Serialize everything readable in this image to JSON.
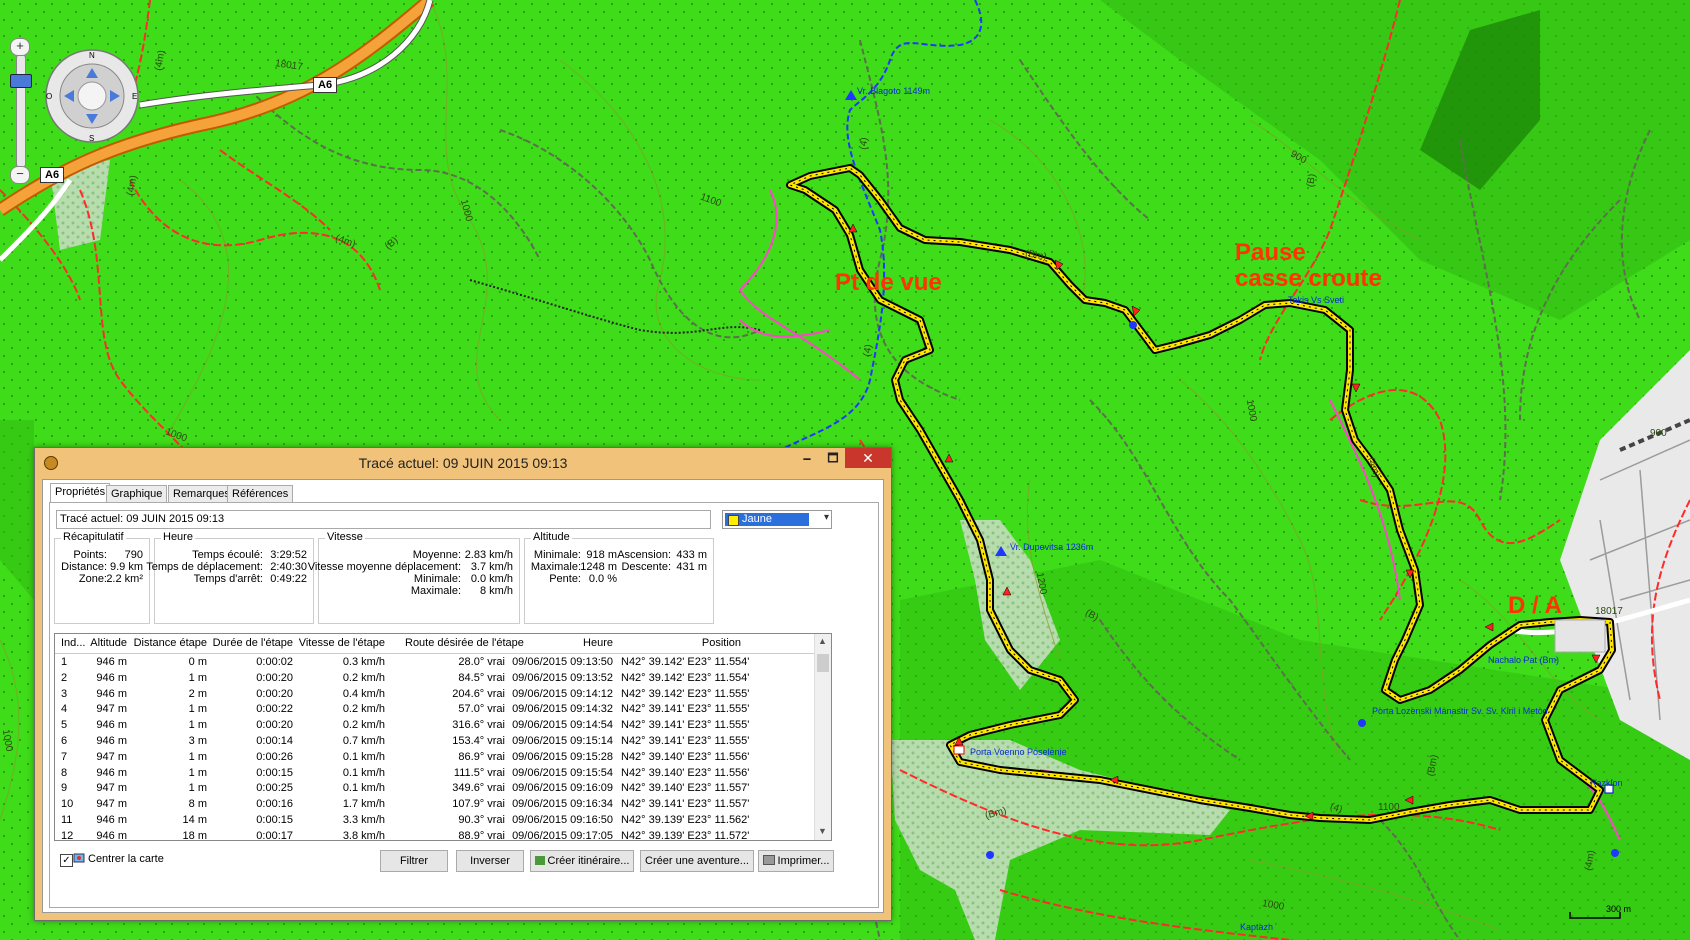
{
  "map": {
    "road_shields": [
      "A6",
      "A6"
    ],
    "road_numbers": [
      "18017",
      "18017"
    ],
    "contours": [
      "1000",
      "1100",
      "1000",
      "1200",
      "1000",
      "1100",
      "1000",
      "900",
      "900",
      "1000"
    ],
    "track_labels": [
      "(4m)",
      "(B)",
      "(4m)",
      "(4)",
      "(4)",
      "(B)",
      "(Bm)",
      "(Bm)",
      "(4m)",
      "(4)",
      "(Bm)",
      "(4m)",
      "(B)",
      "(4m)"
    ],
    "pois": [
      "Vr. Blagoto 1149m",
      "Takis Vs Sveti",
      "Vr. Dupevitsa 1236m",
      "Nachalo Pat (Bm)",
      "Porta Lozenski Manastir Sv. Sv. Kiril i Metod",
      "Porta Voenno Poselenie",
      "Razklon",
      "Kaptazh"
    ],
    "annotations": {
      "viewpoint": "Pt de vue",
      "pause": "Pause\ncasse croute",
      "start": "D / A"
    },
    "scale": "300 m",
    "colors": {
      "background": "#3fdc19",
      "track": "#ffe600",
      "trail_red": "#ff2a2a",
      "trail_blue": "#1f37ff"
    }
  },
  "window": {
    "title": "Tracé actuel: 09 JUIN 2015 09:13",
    "controls": {
      "minimize": "🗕",
      "maximize": "🗖",
      "close": "✕"
    },
    "tabs": [
      "Propriétés",
      "Graphique",
      "Remarques",
      "Références"
    ],
    "name_value": "Tracé actuel: 09 JUIN 2015 09:13",
    "color": {
      "label": "Jaune",
      "swatch": "#ffee00"
    },
    "summary": {
      "title": "Récapitulatif",
      "rows": [
        {
          "label": "Points:",
          "value": "790"
        },
        {
          "label": "Distance:",
          "value": "9.9 km"
        },
        {
          "label": "Zone:",
          "value": "2.2 km²"
        }
      ]
    },
    "time": {
      "title": "Heure",
      "rows": [
        {
          "label": "Temps écoulé:",
          "value": "3:29:52"
        },
        {
          "label": "Temps de déplacement:",
          "value": "2:40:30"
        },
        {
          "label": "Temps d'arrêt:",
          "value": "0:49:22"
        }
      ]
    },
    "speed": {
      "title": "Vitesse",
      "rows": [
        {
          "label": "Moyenne:",
          "value": "2.83 km/h"
        },
        {
          "label": "Vitesse moyenne déplacement:",
          "value": "3.7 km/h"
        },
        {
          "label": "Minimale:",
          "value": "0.0 km/h"
        },
        {
          "label": "Maximale:",
          "value": "8 km/h"
        }
      ]
    },
    "altitude": {
      "title": "Altitude",
      "rows": [
        {
          "label": "Minimale:",
          "value": "918 m"
        },
        {
          "label": "Maximale:",
          "value": "1248 m"
        },
        {
          "label": "Pente:",
          "value": "0.0 %"
        }
      ],
      "rows2": [
        {
          "label": "Ascension:",
          "value": "433 m"
        },
        {
          "label": "Descente:",
          "value": "431 m"
        }
      ]
    },
    "table": {
      "columns": [
        "Ind...",
        "Altitude",
        "Distance étape",
        "Durée de l'étape",
        "Vitesse de l'étape",
        "Route désirée de l'étape",
        "Heure",
        "Position"
      ],
      "rows": [
        [
          "1",
          "946 m",
          "0 m",
          "0:00:02",
          "0.3 km/h",
          "28.0° vrai",
          "09/06/2015 09:13:50",
          "N42° 39.142' E23° 11.554'"
        ],
        [
          "2",
          "946 m",
          "1 m",
          "0:00:20",
          "0.2 km/h",
          "84.5° vrai",
          "09/06/2015 09:13:52",
          "N42° 39.142' E23° 11.554'"
        ],
        [
          "3",
          "946 m",
          "2 m",
          "0:00:20",
          "0.4 km/h",
          "204.6° vrai",
          "09/06/2015 09:14:12",
          "N42° 39.142' E23° 11.555'"
        ],
        [
          "4",
          "947 m",
          "1 m",
          "0:00:22",
          "0.2 km/h",
          "57.0° vrai",
          "09/06/2015 09:14:32",
          "N42° 39.141' E23° 11.555'"
        ],
        [
          "5",
          "946 m",
          "1 m",
          "0:00:20",
          "0.2 km/h",
          "316.6° vrai",
          "09/06/2015 09:14:54",
          "N42° 39.141' E23° 11.555'"
        ],
        [
          "6",
          "946 m",
          "3 m",
          "0:00:14",
          "0.7 km/h",
          "153.4° vrai",
          "09/06/2015 09:15:14",
          "N42° 39.141' E23° 11.555'"
        ],
        [
          "7",
          "947 m",
          "1 m",
          "0:00:26",
          "0.1 km/h",
          "86.9° vrai",
          "09/06/2015 09:15:28",
          "N42° 39.140' E23° 11.556'"
        ],
        [
          "8",
          "946 m",
          "1 m",
          "0:00:15",
          "0.1 km/h",
          "111.5° vrai",
          "09/06/2015 09:15:54",
          "N42° 39.140' E23° 11.556'"
        ],
        [
          "9",
          "947 m",
          "1 m",
          "0:00:25",
          "0.1 km/h",
          "349.6° vrai",
          "09/06/2015 09:16:09",
          "N42° 39.140' E23° 11.557'"
        ],
        [
          "10",
          "947 m",
          "8 m",
          "0:00:16",
          "1.7 km/h",
          "107.9° vrai",
          "09/06/2015 09:16:34",
          "N42° 39.141' E23° 11.557'"
        ],
        [
          "11",
          "946 m",
          "14 m",
          "0:00:15",
          "3.3 km/h",
          "90.3° vrai",
          "09/06/2015 09:16:50",
          "N42° 39.139' E23° 11.562'"
        ],
        [
          "12",
          "946 m",
          "18 m",
          "0:00:17",
          "3.8 km/h",
          "88.9° vrai",
          "09/06/2015 09:17:05",
          "N42° 39.139' E23° 11.572'"
        ]
      ]
    },
    "center_map_label": "Centrer la carte",
    "center_map_checked": true,
    "buttons": {
      "filter": "Filtrer",
      "invert": "Inverser",
      "create_route": "Créer itinéraire...",
      "create_adventure": "Créer une aventure...",
      "print": "Imprimer..."
    }
  }
}
